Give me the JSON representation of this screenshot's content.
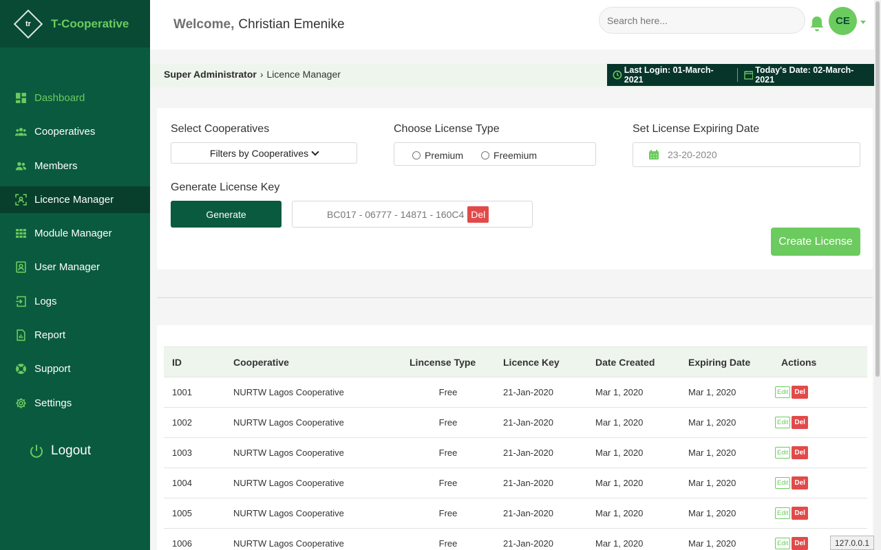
{
  "brand": {
    "logo_text": "tr",
    "name": "T-Cooperative"
  },
  "sidebar": {
    "items": [
      {
        "label": "Dashboard",
        "icon": "dashboard-icon"
      },
      {
        "label": "Cooperatives",
        "icon": "users-group-icon"
      },
      {
        "label": "Members",
        "icon": "members-icon"
      },
      {
        "label": "Licence Manager",
        "icon": "license-icon"
      },
      {
        "label": "Module Manager",
        "icon": "grid-icon"
      },
      {
        "label": "User Manager",
        "icon": "user-badge-icon"
      },
      {
        "label": "Logs",
        "icon": "sign-in-icon"
      },
      {
        "label": "Report",
        "icon": "report-icon"
      },
      {
        "label": "Support",
        "icon": "lifebuoy-icon"
      },
      {
        "label": "Settings",
        "icon": "gear-icon"
      }
    ],
    "logout_label": "Logout"
  },
  "header": {
    "welcome_label": "Welcome,",
    "user_name": "Christian Emenike",
    "search_placeholder": "Search here...",
    "avatar_initials": "CE"
  },
  "breadcrumb": {
    "root": "Super Administrator",
    "current": "Licence Manager",
    "last_login": "Last Login: 01-March-2021",
    "today": "Today's Date: 02-March-2021"
  },
  "form": {
    "select_cooperatives_label": "Select Cooperatives",
    "select_cooperatives_value": "Filters by Cooperatives",
    "license_type_label": "Choose License Type",
    "license_type_options": [
      "Premium",
      "Freemium"
    ],
    "expiring_label": "Set License Expiring Date",
    "expiring_value": "23-20-2020",
    "generate_label": "Generate License Key",
    "generate_button": "Generate",
    "key_value": "BC017 - 06777 - 14871 - 160C4",
    "key_delete": "Del",
    "create_button": "Create License"
  },
  "table": {
    "headers": [
      "ID",
      "Cooperative",
      "Lincense Type",
      "Licence Key",
      "Date Created",
      "Expiring Date",
      "Actions"
    ],
    "edit_label": "Edit",
    "del_label": "Del",
    "rows": [
      {
        "id": "1001",
        "coop": "NURTW Lagos Cooperative",
        "type": "Free",
        "key": "21-Jan-2020",
        "created": "Mar 1, 2020",
        "expiring": "Mar 1, 2020"
      },
      {
        "id": "1002",
        "coop": "NURTW Lagos Cooperative",
        "type": "Free",
        "key": "21-Jan-2020",
        "created": "Mar 1, 2020",
        "expiring": "Mar 1, 2020"
      },
      {
        "id": "1003",
        "coop": "NURTW Lagos Cooperative",
        "type": "Free",
        "key": "21-Jan-2020",
        "created": "Mar 1, 2020",
        "expiring": "Mar 1, 2020"
      },
      {
        "id": "1004",
        "coop": "NURTW Lagos Cooperative",
        "type": "Free",
        "key": "21-Jan-2020",
        "created": "Mar 1, 2020",
        "expiring": "Mar 1, 2020"
      },
      {
        "id": "1005",
        "coop": "NURTW Lagos Cooperative",
        "type": "Free",
        "key": "21-Jan-2020",
        "created": "Mar 1, 2020",
        "expiring": "Mar 1, 2020"
      },
      {
        "id": "1006",
        "coop": "NURTW Lagos Cooperative",
        "type": "Free",
        "key": "21-Jan-2020",
        "created": "Mar 1, 2020",
        "expiring": "Mar 1, 2020"
      }
    ]
  },
  "status": {
    "host": "127.0.0.1"
  },
  "colors": {
    "sidebar": "#0a5a3f",
    "accent": "#6ccb5f",
    "danger": "#e24a4a",
    "dark": "#07352a"
  }
}
